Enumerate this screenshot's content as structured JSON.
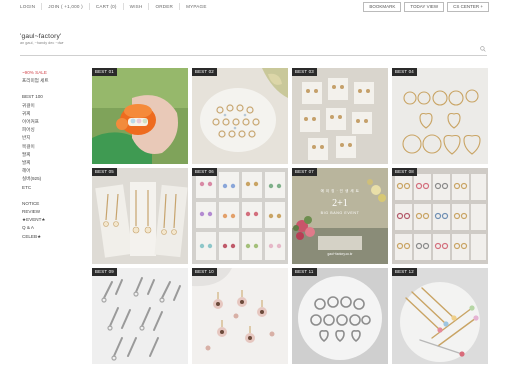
{
  "top_nav": [
    "LOGIN",
    "JOIN ( +1,000 )",
    "CART (0)",
    "WISH",
    "ORDER",
    "MYPAGE"
  ],
  "top_buttons": [
    "BOOKMARK",
    "TODAY VIEW",
    "CS CENTER +"
  ],
  "logo": {
    "title": "'gaul~factory'",
    "subtitle": "an gaul, ~handy dec ~dwr"
  },
  "search": {
    "icon": "search-icon"
  },
  "sidebar": {
    "group1": [
      "~90% SALE",
      "프리미엄 세트"
    ],
    "group2": [
      "BEST 100",
      "귀걸이",
      "귀찌",
      "이어커프",
      "피어싱",
      "반지",
      "목걸이",
      "팔찌",
      "발찌",
      "헤어",
      "실버(925)",
      "ETC"
    ],
    "group3": [
      "NOTICE",
      "REVIEW",
      "★EVENT★",
      "Q & A",
      "CELEB★"
    ]
  },
  "products": [
    {
      "badge": "BEST 01"
    },
    {
      "badge": "BEST 02"
    },
    {
      "badge": "BEST 03"
    },
    {
      "badge": "BEST 04"
    },
    {
      "badge": "BEST 05"
    },
    {
      "badge": "BEST 06"
    },
    {
      "badge": "BEST 07",
      "overlay": {
        "small": "에 이 징 · 인 생 세 트",
        "big": "2+1",
        "sub": "BIG BANG EVENT",
        "tag": "gaul~factory.co.kr"
      }
    },
    {
      "badge": "BEST 08"
    },
    {
      "badge": "BEST 09"
    },
    {
      "badge": "BEST 10"
    },
    {
      "badge": "BEST 11"
    },
    {
      "badge": "BEST 12"
    }
  ],
  "colors": {
    "sale": "#d2484e",
    "badge_bg": "#2a2a2a",
    "divider": "#cfcfcf"
  }
}
